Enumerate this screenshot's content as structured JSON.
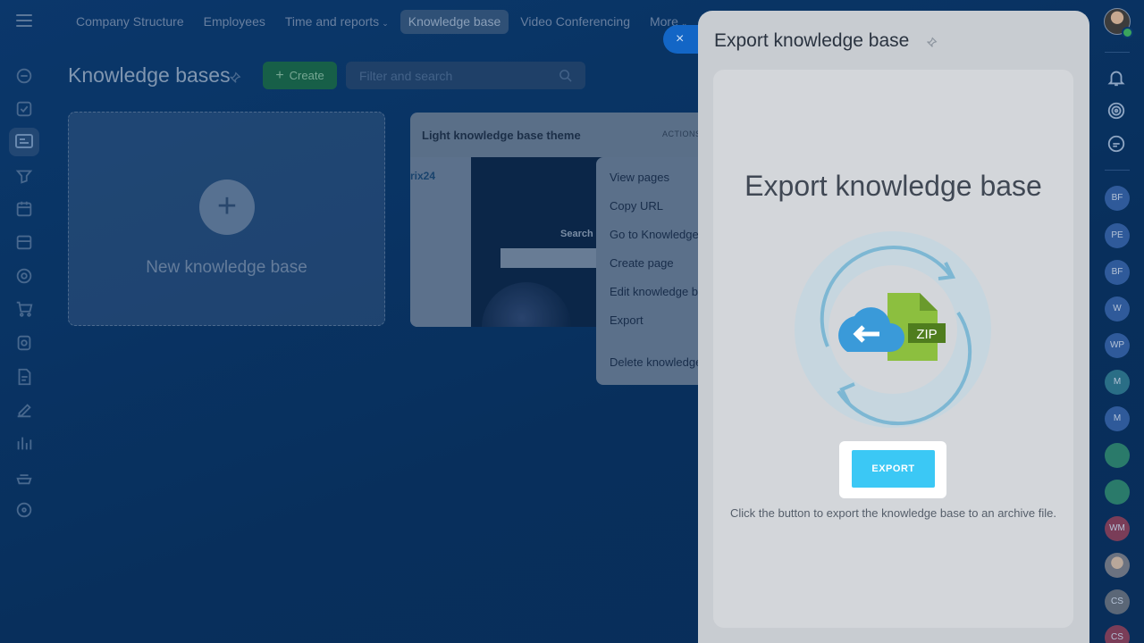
{
  "nav": {
    "items": [
      {
        "label": "Company Structure"
      },
      {
        "label": "Employees"
      },
      {
        "label": "Time and reports",
        "caret": "⌄"
      },
      {
        "label": "Knowledge base",
        "active": true
      },
      {
        "label": "Video Conferencing"
      },
      {
        "label": "More",
        "caret": "⌄"
      }
    ]
  },
  "page": {
    "title": "Knowledge bases",
    "create_label": "Create",
    "create_icon": "+",
    "search_placeholder": "Filter and search"
  },
  "cards": {
    "new_kb": {
      "plus": "+",
      "label": "New knowledge base"
    },
    "theme": {
      "title": "Light knowledge base theme",
      "actions": "ACTIONS",
      "logo": "rix24",
      "search_word": "Search"
    }
  },
  "context_menu": {
    "items": [
      "View pages",
      "Copy URL",
      "Go to Knowledge",
      "Create page",
      "Edit knowledge b",
      "Export",
      "Delete knowledge"
    ]
  },
  "close_button": {
    "label": "×"
  },
  "panel": {
    "title": "Export knowledge base",
    "heading": "Export knowledge base",
    "zip_label": "ZIP",
    "export_label": "EXPORT",
    "hint": "Click the button to export the knowledge base to an archive file."
  },
  "right_bar": {
    "avatars": [
      {
        "initials": "BF"
      },
      {
        "initials": "PE"
      },
      {
        "initials": "BF"
      },
      {
        "initials": "W"
      },
      {
        "initials": "WP"
      },
      {
        "initials": "M"
      },
      {
        "initials": "M"
      },
      {
        "initials": ""
      },
      {
        "initials": ""
      },
      {
        "initials": "WM"
      },
      {
        "initials": ""
      },
      {
        "initials": "CS"
      },
      {
        "initials": "CS"
      }
    ]
  },
  "colors": {
    "accent": "#3bc8f5",
    "create_green": "#1d6f4e",
    "zip_green": "#8cbf3f",
    "cloud_blue": "#3a9ad9"
  }
}
